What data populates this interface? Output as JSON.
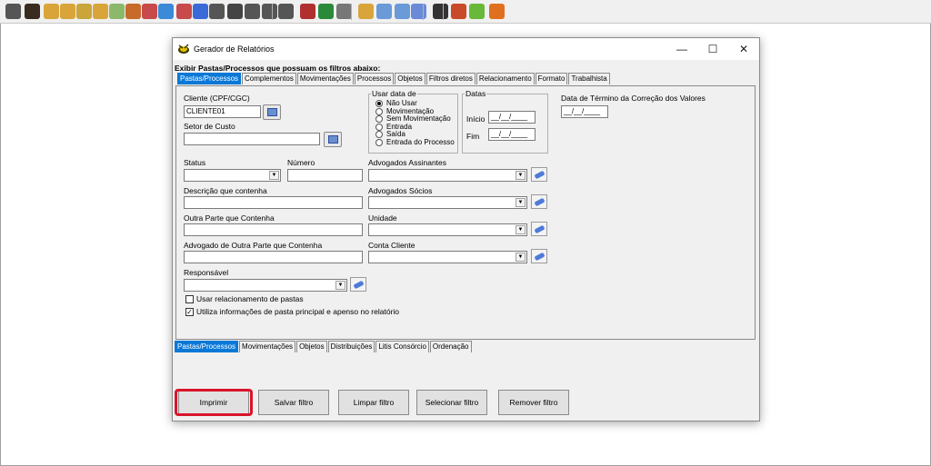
{
  "window": {
    "title": "Gerador de Relatórios",
    "minimize": "—",
    "maximize": "☐",
    "close": "✕"
  },
  "heading": "Exibir Pastas/Processos que possuam os filtros abaixo:",
  "top_tabs": [
    "Pastas/Processos",
    "Complementos",
    "Movimentações",
    "Processos",
    "Objetos",
    "Filtros diretos",
    "Relacionamento",
    "Formato",
    "Trabalhista"
  ],
  "active_top_tab": "Pastas/Processos",
  "form": {
    "cliente_label": "Cliente (CPF/CGC)",
    "cliente_value": "CLIENTE01",
    "setor_label": "Setor de Custo",
    "setor_value": "",
    "status_label": "Status",
    "numero_label": "Número",
    "descricao_label": "Descrição que contenha",
    "outra_parte_label": "Outra Parte que Contenha",
    "advogado_outra_label": "Advogado de Outra Parte que Contenha",
    "responsavel_label": "Responsável",
    "usar_data_label": "Usar data de",
    "usar_data_options": [
      "Não Usar",
      "Movimentação",
      "Sem Movimentação",
      "Entrada",
      "Saída",
      "Entrada do Processo"
    ],
    "usar_data_selected": "Não Usar",
    "datas_label": "Datas",
    "inicio_label": "Início",
    "inicio_value": "__/__/____",
    "fim_label": "Fim",
    "fim_value": "__/__/____",
    "termino_label": "Data de Término da Correção dos Valores",
    "termino_value": "__/__/____",
    "adv_assinantes_label": "Advogados Assinantes",
    "adv_socios_label": "Advogados Sócios",
    "unidade_label": "Unidade",
    "conta_cliente_label": "Conta Cliente",
    "chk_relacionamento": "Usar relacionamento de pastas",
    "chk_relacionamento_checked": false,
    "chk_utiliza": "Utiliza informações de pasta principal e apenso no relatório",
    "chk_utiliza_checked": true,
    "checkmark": "✓",
    "arrow": "▼"
  },
  "bottom_tabs": [
    "Pastas/Processos",
    "Movimentações",
    "Objetos",
    "Distribuições",
    "Litis Consórcio",
    "Ordenação"
  ],
  "active_bottom_tab": "Pastas/Processos",
  "buttons": {
    "imprimir": "Imprimir",
    "salvar": "Salvar filtro",
    "limpar": "Limpar filtro",
    "selecionar": "Selecionar filtro",
    "remover": "Remover filtro"
  },
  "toolbar_icons": [
    "people-icon",
    "person-icon",
    "folder-check-icon",
    "folder-check-icon",
    "folder-search-icon",
    "folder-check-icon",
    "agenda-icon",
    "pen-icon",
    "calendar-icon",
    "disk-icon",
    "chart-icon",
    "card-icon",
    "handshake-icon",
    "user-icon",
    "users-icon",
    "group-icon",
    "group-icon",
    "scale-icon",
    "scale-icon",
    "photo-icon",
    "folder-check-icon",
    "bars-icon",
    "bars-icon",
    "grid-icon",
    "scissors-icon",
    "recycle-icon",
    "money-icon",
    "exit-icon"
  ],
  "colors": {
    "accent": "#0a78d7",
    "highlight": "#d9142b"
  }
}
